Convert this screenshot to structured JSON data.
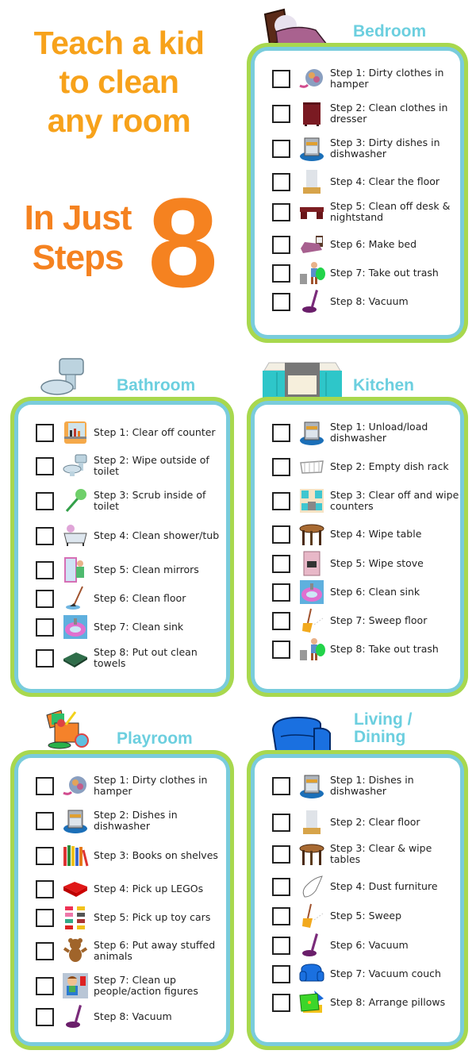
{
  "headline": {
    "lines": [
      "Teach a kid",
      "to clean",
      "any room"
    ],
    "steps_words": [
      "In Just",
      "Steps"
    ],
    "steps_number": "8"
  },
  "colors": {
    "headline_orange": "#f7a21b",
    "steps_orange": "#f58220",
    "title_blue": "#6ccfdf",
    "outer_border_green": "#a8d84e",
    "inner_border_blue": "#79ccdc"
  },
  "rooms": {
    "bedroom": {
      "title": "Bedroom",
      "icon": "bed-icon",
      "steps": [
        {
          "label": "Step 1: Dirty clothes in hamper",
          "icon": "laundry-hamper-icon",
          "checked": false
        },
        {
          "label": "Step 2: Clean clothes in dresser",
          "icon": "dresser-icon",
          "checked": false
        },
        {
          "label": "Step 3: Dirty dishes in dishwasher",
          "icon": "dishwasher-icon",
          "checked": false
        },
        {
          "label": "Step 4: Clear the floor",
          "icon": "floor-icon",
          "checked": false
        },
        {
          "label": "Step 5: Clean off desk & nightstand",
          "icon": "desk-icon",
          "checked": false
        },
        {
          "label": "Step 6: Make bed",
          "icon": "bed-icon",
          "checked": false
        },
        {
          "label": "Step 7: Take out trash",
          "icon": "trash-icon",
          "checked": false
        },
        {
          "label": "Step 8: Vacuum",
          "icon": "vacuum-icon",
          "checked": false
        }
      ]
    },
    "bathroom": {
      "title": "Bathroom",
      "icon": "toilet-icon",
      "steps": [
        {
          "label": "Step 1: Clear off counter",
          "icon": "counter-icon",
          "checked": false
        },
        {
          "label": "Step 2: Wipe outside of toilet",
          "icon": "toilet-icon",
          "checked": false
        },
        {
          "label": "Step 3: Scrub inside of toilet",
          "icon": "toilet-brush-icon",
          "checked": false
        },
        {
          "label": "Step 4: Clean shower/tub",
          "icon": "bathtub-icon",
          "checked": false
        },
        {
          "label": "Step 5: Clean mirrors",
          "icon": "mirror-icon",
          "checked": false
        },
        {
          "label": "Step 6: Clean floor",
          "icon": "mop-icon",
          "checked": false
        },
        {
          "label": "Step 7: Clean sink",
          "icon": "sink-icon",
          "checked": false
        },
        {
          "label": "Step 8: Put out clean towels",
          "icon": "towels-icon",
          "checked": false
        }
      ]
    },
    "kitchen": {
      "title": "Kitchen",
      "icon": "kitchen-stove-icon",
      "steps": [
        {
          "label": "Step 1: Unload/load dishwasher",
          "icon": "dishwasher-icon",
          "checked": false
        },
        {
          "label": "Step 2: Empty dish rack",
          "icon": "dish-rack-icon",
          "checked": false
        },
        {
          "label": "Step 3: Clear off and wipe counters",
          "icon": "counters-icon",
          "checked": false
        },
        {
          "label": "Step 4: Wipe table",
          "icon": "table-icon",
          "checked": false
        },
        {
          "label": "Step 5: Wipe stove",
          "icon": "stove-icon",
          "checked": false
        },
        {
          "label": "Step 6: Clean sink",
          "icon": "sink-icon",
          "checked": false
        },
        {
          "label": "Step 7: Sweep floor",
          "icon": "broom-icon",
          "checked": false
        },
        {
          "label": "Step 8: Take out trash",
          "icon": "trash-icon",
          "checked": false
        }
      ]
    },
    "playroom": {
      "title": "Playroom",
      "icon": "toy-box-icon",
      "steps": [
        {
          "label": "Step 1: Dirty clothes in hamper",
          "icon": "laundry-hamper-icon",
          "checked": false
        },
        {
          "label": "Step 2: Dishes in dishwasher",
          "icon": "dishwasher-icon",
          "checked": false
        },
        {
          "label": "Step 3: Books on shelves",
          "icon": "books-icon",
          "checked": false
        },
        {
          "label": "Step 4: Pick up LEGOs",
          "icon": "lego-brick-icon",
          "checked": false
        },
        {
          "label": "Step 5: Pick up toy cars",
          "icon": "toy-cars-icon",
          "checked": false
        },
        {
          "label": "Step 6: Put away stuffed animals",
          "icon": "teddy-bear-icon",
          "checked": false
        },
        {
          "label": "Step 7: Clean up people/action figures",
          "icon": "action-figure-icon",
          "checked": false
        },
        {
          "label": "Step 8: Vacuum",
          "icon": "vacuum-icon",
          "checked": false
        }
      ]
    },
    "living": {
      "title_lines": [
        "Living /",
        "Dining"
      ],
      "icon": "armchair-icon",
      "steps": [
        {
          "label": "Step 1: Dishes in dishwasher",
          "icon": "dishwasher-icon",
          "checked": false
        },
        {
          "label": "Step 2: Clear floor",
          "icon": "floor-icon",
          "checked": false
        },
        {
          "label": "Step 3: Clear & wipe tables",
          "icon": "table-icon",
          "checked": false
        },
        {
          "label": "Step 4: Dust furniture",
          "icon": "duster-cloth-icon",
          "checked": false
        },
        {
          "label": "Step 5: Sweep",
          "icon": "broom-icon",
          "checked": false
        },
        {
          "label": "Step 6: Vacuum",
          "icon": "vacuum-icon",
          "checked": false
        },
        {
          "label": "Step 7: Vacuum couch",
          "icon": "couch-icon",
          "checked": false
        },
        {
          "label": "Step 8: Arrange pillows",
          "icon": "pillows-icon",
          "checked": false
        }
      ]
    }
  }
}
